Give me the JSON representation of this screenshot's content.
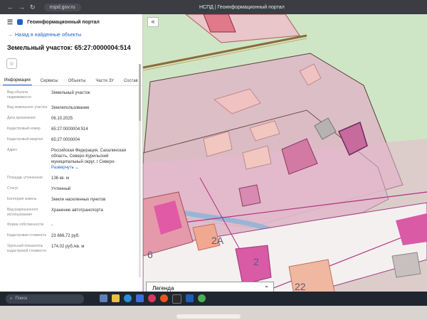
{
  "browser": {
    "url": "nspd.gov.ru",
    "tab_title": "НСПД | Геоинформационный портал"
  },
  "panel": {
    "portal_name": "Геоинформационный портал",
    "back_link": "Назад в найденные объекты",
    "title": "Земельный участок: 65:27:0000004:514",
    "tabs": [
      "Информация",
      "Сервисы",
      "Объекты",
      "Части ЗУ",
      "Состав"
    ],
    "attributes": [
      {
        "key": "Вид объекта недвижимости",
        "value": "Земельный участок"
      },
      {
        "key": "Вид земельного участка",
        "value": "Землепользование"
      },
      {
        "key": "Дата присвоения",
        "value": "06.10.2025"
      },
      {
        "key": "Кадастровый номер",
        "value": "65:27:0000004:514"
      },
      {
        "key": "Кадастровый квартал",
        "value": "65:27:0000004"
      },
      {
        "key": "Адрес",
        "value": "Российская Федерация, Сахалинская область, Северо-Курильский муниципальный округ, г Северо-"
      },
      {
        "key": "Площадь уточненная",
        "value": "136 кв. м"
      },
      {
        "key": "Статус",
        "value": "Учтенный"
      },
      {
        "key": "Категория земель",
        "value": "Земли населенных пунктов"
      },
      {
        "key": "Вид разрешенного использования",
        "value": "Хранение автотранспорта"
      },
      {
        "key": "Форма собственности",
        "value": "-"
      },
      {
        "key": "Кадастровая стоимость",
        "value": "23 666,72 руб."
      },
      {
        "key": "Удельный показатель кадастровой стоимости",
        "value": "174,02 руб./кв. м"
      }
    ],
    "expand_label": "Развернуть"
  },
  "map": {
    "labels": [
      "2А",
      "6",
      "2",
      "22"
    ],
    "legend_label": "Легенда"
  },
  "taskbar": {
    "search_placeholder": "Поиск"
  }
}
